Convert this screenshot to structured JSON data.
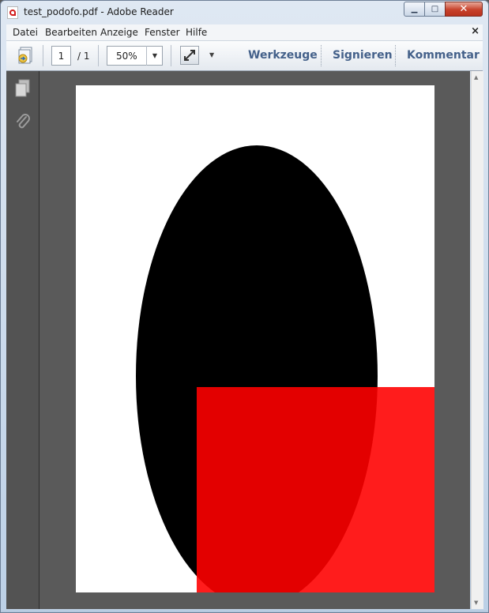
{
  "window": {
    "title": "test_podofo.pdf - Adobe Reader",
    "minimize_label": "▁",
    "maximize_label": "□",
    "close_label": "✕"
  },
  "menubar": {
    "items": [
      "Datei",
      "Bearbeiten",
      "Anzeige",
      "Fenster",
      "Hilfe"
    ],
    "close_label": "×"
  },
  "toolbar": {
    "page_number": "1",
    "page_total": "/ 1",
    "zoom": "50%",
    "tools_label": "Werkzeuge",
    "sign_label": "Signieren",
    "comment_label": "Kommentar"
  },
  "document": {
    "ellipse_color": "#000000",
    "rectangle_color": "#ff0000"
  },
  "icons": [
    "pdf-file-icon",
    "create-pdf-icon",
    "pages-panel-icon",
    "attachments-icon",
    "fit-page-icon"
  ]
}
